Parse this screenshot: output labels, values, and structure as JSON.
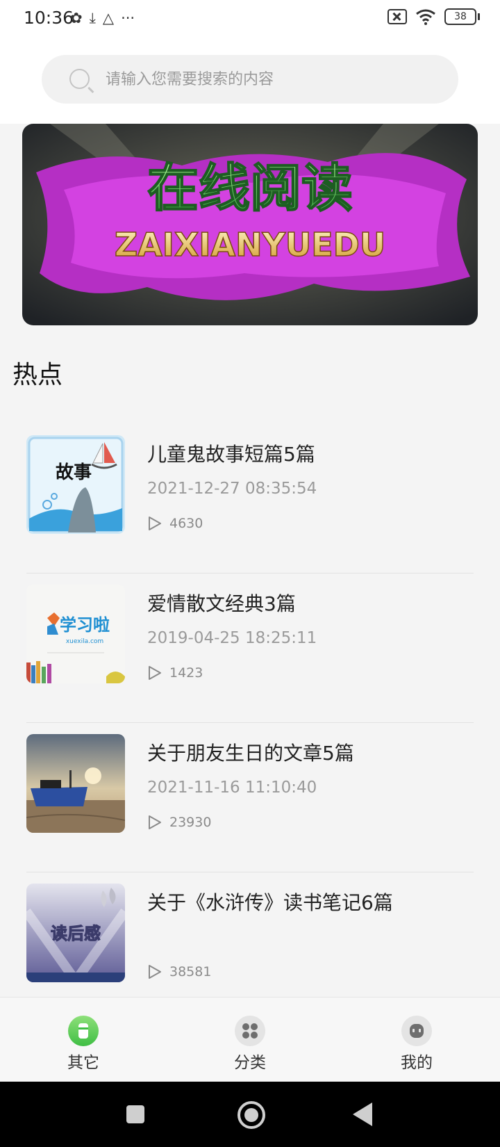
{
  "status_bar": {
    "time": "10:36",
    "left_icons": [
      "pinwheel-icon",
      "download-done-icon",
      "drive-icon",
      "more-dots-icon"
    ],
    "more_glyph": "···",
    "battery": "38"
  },
  "search": {
    "placeholder": "请输入您需要搜索的内容"
  },
  "banner": {
    "title": "在线阅读",
    "subtitle": "ZAIXIANYUEDU"
  },
  "section": {
    "title": "热点"
  },
  "articles": [
    {
      "title": "儿童鬼故事短篇5篇",
      "date": "2021-12-27 08:35:54",
      "views": "4630",
      "thumb_text": "故事"
    },
    {
      "title": "爱情散文经典3篇",
      "date": "2019-04-25 18:25:11",
      "views": "1423",
      "thumb_text": "学习啦",
      "thumb_sub": "xuexila.com"
    },
    {
      "title": "关于朋友生日的文章5篇",
      "date": "2021-11-16 11:10:40",
      "views": "23930"
    },
    {
      "title": "关于《水浒传》读书笔记6篇",
      "date": "",
      "views": "38581",
      "thumb_text": "读后感"
    }
  ],
  "tabs": [
    {
      "label": "其它",
      "icon": "other-icon",
      "active": true
    },
    {
      "label": "分类",
      "icon": "category-grid-icon",
      "active": false
    },
    {
      "label": "我的",
      "icon": "profile-icon",
      "active": false
    }
  ],
  "colors": {
    "accent": "#3fbe44",
    "banner_magenta": "#c832d8",
    "banner_text_green": "#5ee35a"
  }
}
